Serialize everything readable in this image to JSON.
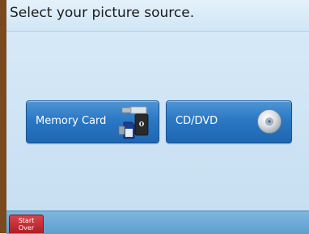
{
  "header": {
    "title": "Select your picture source."
  },
  "sources": [
    {
      "label": "Memory Card",
      "icon": "memory-card-icon"
    },
    {
      "label": "CD/DVD",
      "icon": "disc-icon"
    }
  ],
  "footer": {
    "start_over_line1": "Start",
    "start_over_line2": "Over"
  },
  "colors": {
    "button_blue": "#2b78c4",
    "start_over_red": "#c22b33",
    "background": "#c9e0f3"
  }
}
